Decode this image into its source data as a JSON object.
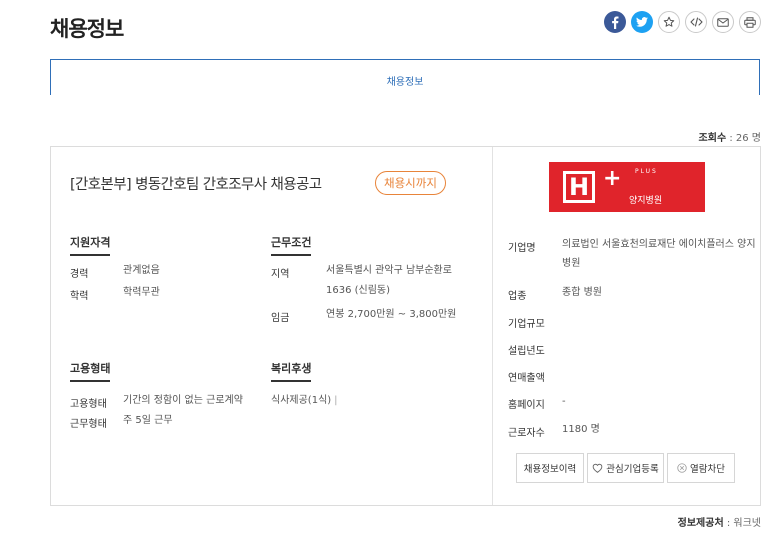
{
  "page": {
    "title": "채용정보"
  },
  "tab": {
    "label": "채용정보"
  },
  "views": {
    "label": "조회수",
    "count": ": 26 명"
  },
  "job": {
    "title": "[간호본부] 병동간호팀 간호조무사 채용공고",
    "deadline": "채용시까지",
    "sections": {
      "qualification": {
        "title": "지원자격",
        "rows": [
          {
            "label": "경력",
            "value": "관계없음"
          },
          {
            "label": "학력",
            "value": "학력무관"
          }
        ]
      },
      "conditions": {
        "title": "근무조건",
        "rows": [
          {
            "label": "지역",
            "value": "서울특별시 관악구 남부순환로 1636 (신림동)"
          },
          {
            "label": "임금",
            "value": "연봉 2,700만원 ~ 3,800만원"
          }
        ]
      },
      "employment": {
        "title": "고용형태",
        "rows": [
          {
            "label": "고용형태",
            "value": "기간의 정함이 없는 근로계약"
          },
          {
            "label": "근무형태",
            "value": "주 5일 근무"
          }
        ]
      },
      "welfare": {
        "title": "복리후생",
        "value": "식사제공(1식)",
        "separator": "|"
      }
    }
  },
  "company": {
    "logo": {
      "letter": "H",
      "plus": "+",
      "plus_word": "PLUS",
      "name": "양지병원"
    },
    "rows": [
      {
        "label": "기업명",
        "value": "의료법인 서울효천의료재단 에이치플러스 양지병원"
      },
      {
        "label": "업종",
        "value": "종합 병원"
      },
      {
        "label": "기업규모",
        "value": ""
      },
      {
        "label": "설립년도",
        "value": ""
      },
      {
        "label": "연매출액",
        "value": ""
      },
      {
        "label": "홈페이지",
        "value": "-"
      },
      {
        "label": "근로자수",
        "value": "1180 명"
      }
    ],
    "buttons": {
      "history": "채용정보이력",
      "favorite": "관심기업등록",
      "block": "열람차단"
    }
  },
  "source": {
    "label": "정보제공처",
    "value": ": 워크넷"
  },
  "colors": {
    "accent": "#2f6fb8",
    "deadline": "#e8843a",
    "logo": "#e0242b",
    "facebook": "#3b5998",
    "twitter": "#1da1f2"
  }
}
